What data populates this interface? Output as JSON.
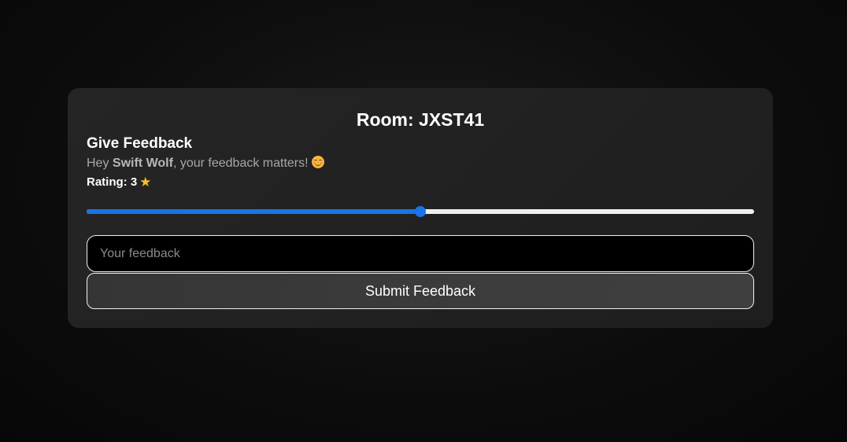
{
  "room": {
    "title": "Room: JXST41"
  },
  "feedback_form": {
    "heading": "Give Feedback",
    "greeting_prefix": "Hey ",
    "user_name": "Swift Wolf",
    "greeting_suffix": ", your feedback matters!",
    "greeting_emoji": "smiling-face-emoji",
    "rating_label": "Rating: 3",
    "rating_icon": "star-icon",
    "rating_value": 3,
    "rating_min": 1,
    "rating_max": 5,
    "input_placeholder": "Your feedback",
    "input_value": "",
    "submit_label": "Submit Feedback"
  },
  "colors": {
    "accent": "#1a73e8",
    "card_background": "#222222",
    "page_background": "#0a0a0a",
    "star": "#f6c026"
  }
}
